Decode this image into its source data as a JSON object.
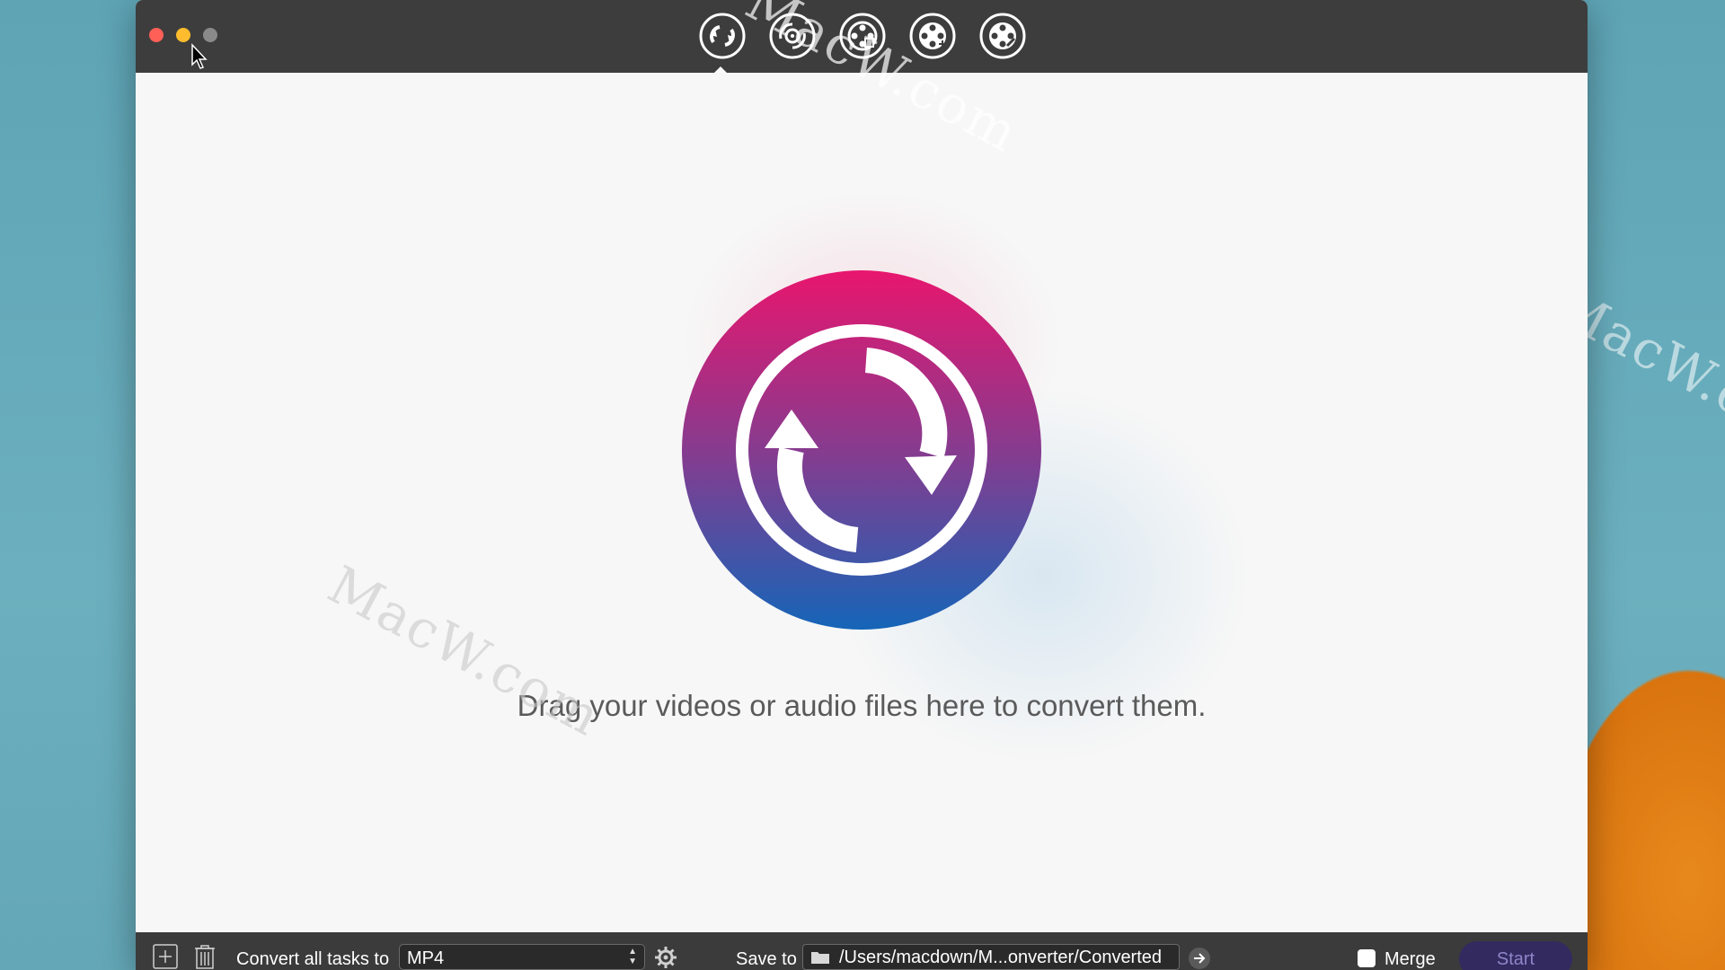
{
  "window": {
    "toolbar": {
      "tools": [
        {
          "name": "convert-tool",
          "icon": "convert-icon"
        },
        {
          "name": "dvd-tool",
          "icon": "dvd-icon"
        },
        {
          "name": "media-info-tool",
          "icon": "film-reel-info-icon"
        },
        {
          "name": "add-media-tool",
          "icon": "film-reel-plus-icon"
        },
        {
          "name": "edit-media-tool",
          "icon": "film-reel-edit-icon"
        }
      ]
    },
    "main": {
      "hero_icon": "convert-icon",
      "drop_message": "Drag your videos or audio files here to convert them."
    },
    "bottombar": {
      "convert_label": "Convert all tasks to",
      "format_value": "MP4",
      "save_label": "Save to",
      "save_path": "/Users/macdown/M...onverter/Converted",
      "merge_label": "Merge",
      "merge_checked": false,
      "start_label": "Start"
    }
  },
  "watermark": {
    "text": "MacW.com"
  },
  "colors": {
    "titlebar": "#3d3d3d",
    "hero_top": "#e8166e",
    "hero_bottom": "#1565b8",
    "start_button": "#332a60"
  }
}
